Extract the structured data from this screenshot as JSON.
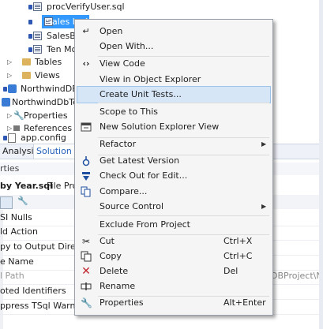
{
  "tree": {
    "items": [
      {
        "label": "procVerifyUser.sql"
      },
      {
        "label": "Sales by Year.sql"
      },
      {
        "label": "SalesBy"
      },
      {
        "label": "Ten Mo"
      },
      {
        "label": "Tables"
      },
      {
        "label": "Views"
      },
      {
        "label": "NorthwindDBP"
      },
      {
        "label": "NorthwindDbTest"
      },
      {
        "label": "Properties"
      },
      {
        "label": "References"
      },
      {
        "label": "app.config"
      }
    ]
  },
  "tabs": {
    "analysis": "Analysis",
    "solution": "Solution Ex"
  },
  "properties": {
    "title": "rties",
    "object_name": "by Year.sql",
    "object_type": "File Prop",
    "rows": [
      {
        "name": "SI Nulls"
      },
      {
        "name": "ld Action"
      },
      {
        "name": "py to Output Directo"
      },
      {
        "name": "e Name"
      },
      {
        "name": "l Path",
        "value": "DBProject\\Nor"
      },
      {
        "name": "oted Identifiers"
      },
      {
        "name": "ppress TSql Warnings"
      }
    ]
  },
  "menu": {
    "items": {
      "open": {
        "label": "Open",
        "icon": "open-icon"
      },
      "open_with": {
        "label": "Open With..."
      },
      "view_code": {
        "label": "View Code",
        "icon": "code-icon"
      },
      "view_object_explorer": {
        "label": "View in Object Explorer"
      },
      "create_unit_tests": {
        "label": "Create Unit Tests..."
      },
      "scope_to_this": {
        "label": "Scope to This"
      },
      "new_solution_explorer_view": {
        "label": "New Solution Explorer View",
        "icon": "new-view-icon"
      },
      "refactor": {
        "label": "Refactor"
      },
      "get_latest_version": {
        "label": "Get Latest Version",
        "icon": "get-latest-icon"
      },
      "check_out_for_edit": {
        "label": "Check Out for Edit...",
        "icon": "checkout-icon"
      },
      "compare": {
        "label": "Compare...",
        "icon": "compare-icon"
      },
      "source_control": {
        "label": "Source Control"
      },
      "exclude_from_project": {
        "label": "Exclude From Project"
      },
      "cut": {
        "label": "Cut",
        "shortcut": "Ctrl+X",
        "icon": "scissors-icon"
      },
      "copy": {
        "label": "Copy",
        "shortcut": "Ctrl+C",
        "icon": "copy-icon"
      },
      "delete": {
        "label": "Delete",
        "shortcut": "Del",
        "icon": "delete-icon"
      },
      "rename": {
        "label": "Rename",
        "icon": "rename-icon"
      },
      "properties": {
        "label": "Properties",
        "shortcut": "Alt+Enter",
        "icon": "wrench-icon"
      }
    }
  },
  "colors": {
    "selection": "#3399ff",
    "menu_background": "#f5f5f5",
    "menu_highlight": "#d6e6f7",
    "tab_active_text": "#1f5fb8"
  }
}
